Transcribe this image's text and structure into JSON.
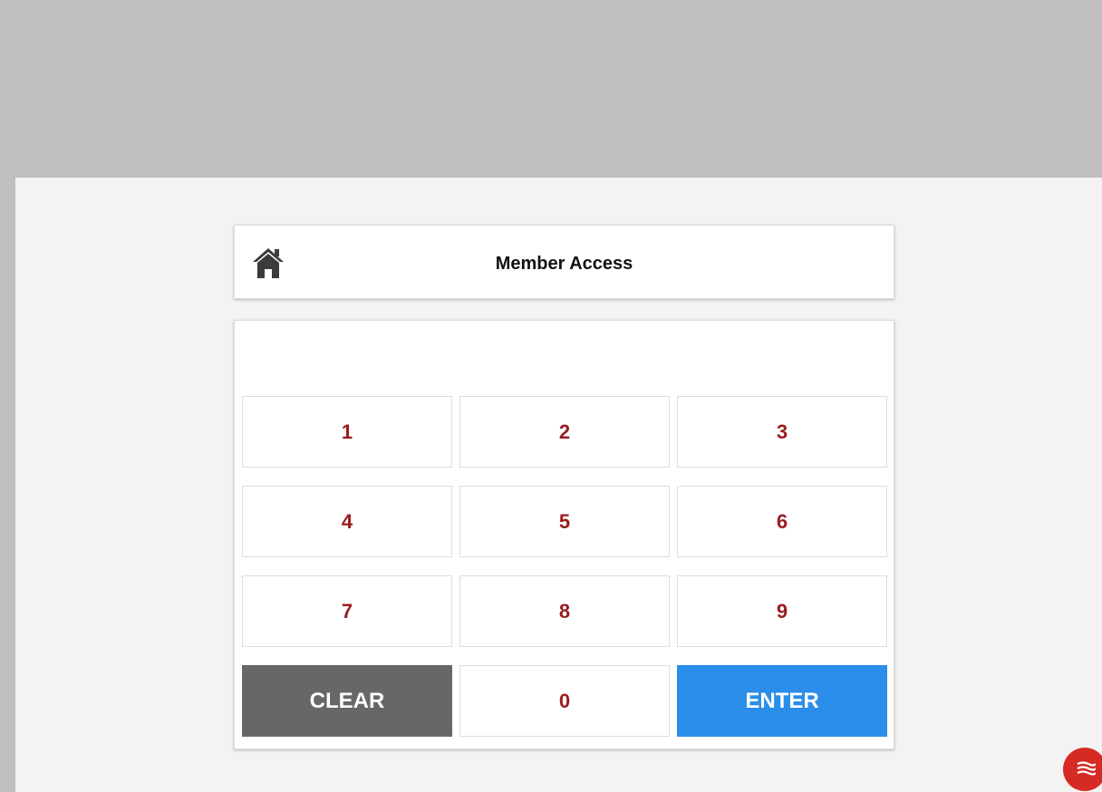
{
  "header": {
    "title": "Member Access",
    "home_icon": "home-icon"
  },
  "pin_display": {
    "value": ""
  },
  "keypad": {
    "keys": [
      {
        "label": "1"
      },
      {
        "label": "2"
      },
      {
        "label": "3"
      },
      {
        "label": "4"
      },
      {
        "label": "5"
      },
      {
        "label": "6"
      },
      {
        "label": "7"
      },
      {
        "label": "8"
      },
      {
        "label": "9"
      },
      {
        "label": "CLEAR"
      },
      {
        "label": "0"
      },
      {
        "label": "ENTER"
      }
    ]
  },
  "floating_button": {
    "icon": "menu-waves-icon"
  },
  "colors": {
    "key_digit_text": "#9b1b1f",
    "clear_bg": "#676767",
    "enter_bg": "#2b8eea",
    "fab_bg": "#d62a24",
    "top_banner_bg": "#c0c0c0",
    "content_bg": "#f3f3f3"
  }
}
